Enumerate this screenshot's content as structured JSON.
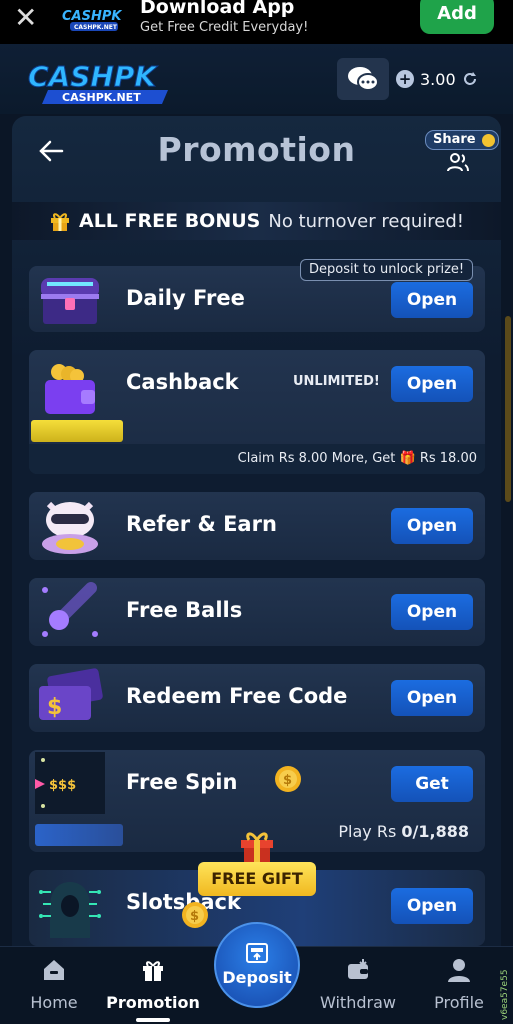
{
  "banner": {
    "logo_text": "CASHPK",
    "logo_sub": "CASHPK.NET",
    "title": "Download App",
    "subtitle": "Get Free Credit Everyday!",
    "add_label": "Add"
  },
  "header": {
    "logo_text": "CASHPK",
    "logo_sub": "CASHPK.NET",
    "balance": "3.00"
  },
  "page": {
    "title": "Promotion",
    "share_label": "Share"
  },
  "bonus": {
    "strong": "ALL FREE BONUS",
    "light": "No turnover required!"
  },
  "promos": {
    "daily": {
      "name": "Daily Free",
      "button": "Open",
      "badge": "Deposit to unlock prize!"
    },
    "cashback": {
      "name": "Cashback",
      "button": "Open",
      "tag": "UNLIMITED!",
      "claim_prefix": "Claim Rs 8.00 More, Get",
      "claim_amount": "Rs 18.00"
    },
    "refer": {
      "name": "Refer & Earn",
      "button": "Open"
    },
    "balls": {
      "name": "Free Balls",
      "button": "Open"
    },
    "redeem": {
      "name": "Redeem Free Code",
      "button": "Open"
    },
    "spin": {
      "name": "Free Spin",
      "button": "Get",
      "play_prefix": "Play Rs",
      "play_value": "0/1,888",
      "spin_label": "$$$"
    },
    "slots": {
      "name": "Slotsback",
      "button": "Open"
    }
  },
  "free_gift": "FREE GIFT",
  "nav": {
    "home": "Home",
    "promotion": "Promotion",
    "deposit": "Deposit",
    "withdraw": "Withdraw",
    "profile": "Profile"
  },
  "side_tag": "v6ea57e55",
  "colors": {
    "accent_blue": "#1b6ce0",
    "gold": "#f0b820",
    "background": "#0b1626"
  }
}
